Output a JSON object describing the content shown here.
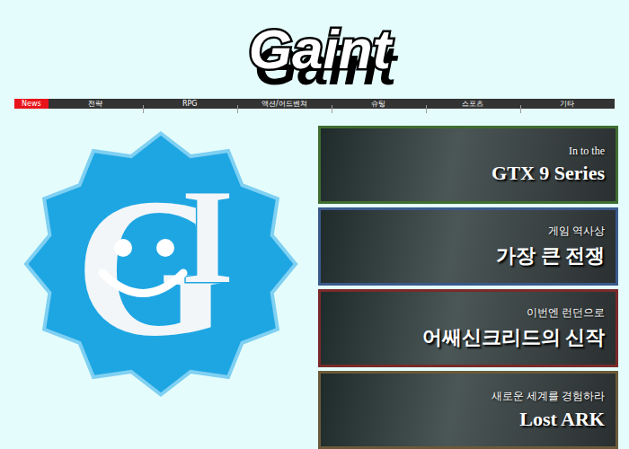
{
  "logo": {
    "text": "Gaint"
  },
  "nav": {
    "items": [
      {
        "label": "News",
        "selected": true
      },
      {
        "label": "전략",
        "selected": false
      },
      {
        "label": "RPG",
        "selected": false
      },
      {
        "label": "액션/어드벤쳐",
        "selected": false
      },
      {
        "label": "슈팅",
        "selected": false
      },
      {
        "label": "스포츠",
        "selected": false
      },
      {
        "label": "기타",
        "selected": false
      }
    ]
  },
  "badge": {
    "letters": [
      "G",
      "I"
    ]
  },
  "banners": [
    {
      "small": "In to the",
      "big": "GTX 9 Series",
      "color": "#3f6e31"
    },
    {
      "small": "게임 역사상",
      "big": "가장 큰 전쟁",
      "color": "#3a5a8c"
    },
    {
      "small": "이번엔 런던으로",
      "big": "어쌔신크리드의 신작",
      "color": "#7a2a2a"
    },
    {
      "small": "새로운 세계를 경험하라",
      "big": "Lost ARK",
      "color": "#6b5a3a"
    }
  ]
}
